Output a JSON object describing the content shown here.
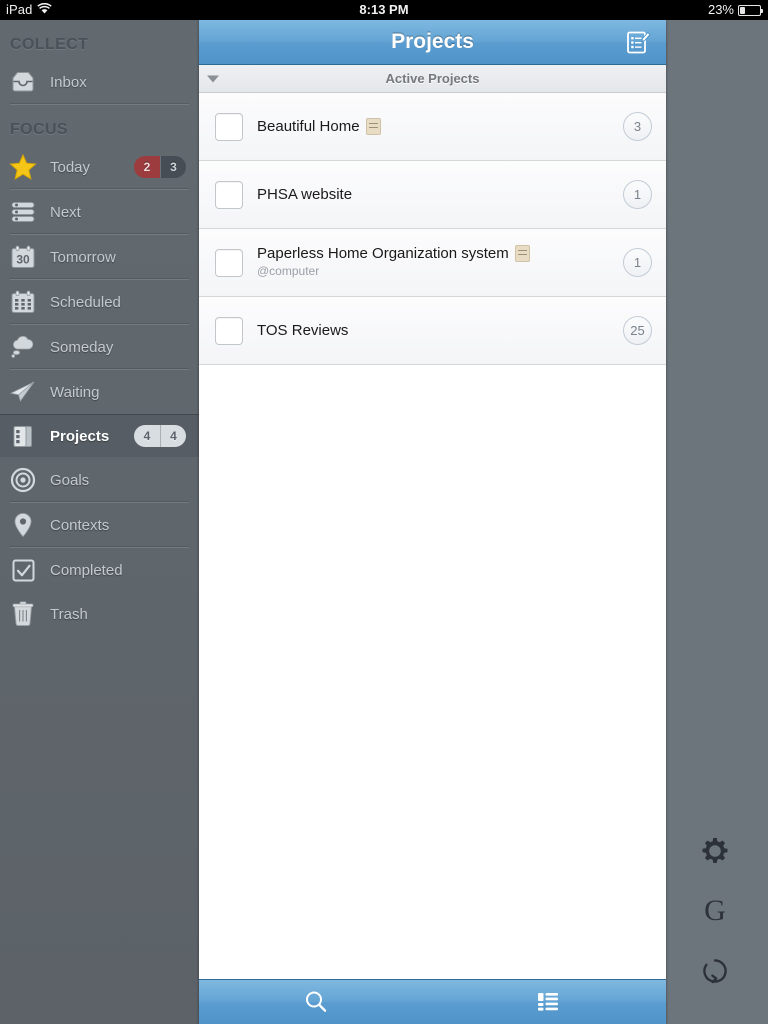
{
  "statusbar": {
    "device": "iPad",
    "wifi_icon": "wifi-icon",
    "time": "8:13 PM",
    "battery_percent": "23%",
    "battery_icon": "battery-icon"
  },
  "sidebar": {
    "groups": [
      {
        "header": "COLLECT",
        "items": [
          {
            "label": "Inbox",
            "icon": "inbox-tray-icon",
            "selected": false,
            "badges": []
          }
        ]
      },
      {
        "header": "FOCUS",
        "items": [
          {
            "label": "Today",
            "icon": "star-icon",
            "selected": false,
            "badges": [
              {
                "value": "2",
                "style": "red"
              },
              {
                "value": "3",
                "style": "dark"
              }
            ]
          },
          {
            "label": "Next",
            "icon": "list-stack-icon",
            "selected": false,
            "badges": []
          },
          {
            "label": "Tomorrow",
            "icon": "calendar-30-icon",
            "selected": false,
            "badges": []
          },
          {
            "label": "Scheduled",
            "icon": "calendar-grid-icon",
            "selected": false,
            "badges": []
          },
          {
            "label": "Someday",
            "icon": "thought-cloud-icon",
            "selected": false,
            "badges": []
          },
          {
            "label": "Waiting",
            "icon": "paper-plane-icon",
            "selected": false,
            "badges": []
          },
          {
            "label": "Projects",
            "icon": "projects-binder-icon",
            "selected": true,
            "badges": [
              {
                "value": "4",
                "style": "light"
              },
              {
                "value": "4",
                "style": "light"
              }
            ]
          },
          {
            "label": "Goals",
            "icon": "target-icon",
            "selected": false,
            "badges": []
          },
          {
            "label": "Contexts",
            "icon": "map-pin-icon",
            "selected": false,
            "badges": []
          },
          {
            "label": "Completed",
            "icon": "checkbox-checked-icon",
            "selected": false,
            "badges": []
          },
          {
            "label": "Trash",
            "icon": "trash-icon",
            "selected": false,
            "badges": []
          }
        ]
      }
    ]
  },
  "main": {
    "navbar": {
      "title": "Projects",
      "compose_icon": "compose-note-icon"
    },
    "section": {
      "title": "Active Projects",
      "collapse_icon": "triangle-down-icon",
      "expanded": true
    },
    "rows": [
      {
        "title": "Beautiful Home",
        "subtitle": "",
        "has_note": true,
        "count": "3"
      },
      {
        "title": "PHSA website",
        "subtitle": "",
        "has_note": false,
        "count": "1"
      },
      {
        "title": "Paperless Home Organization system",
        "subtitle": "@computer",
        "has_note": true,
        "count": "1"
      },
      {
        "title": "TOS Reviews",
        "subtitle": "",
        "has_note": false,
        "count": "25"
      }
    ],
    "toolbar": {
      "search_icon": "search-icon",
      "group_icon": "group-list-icon"
    }
  },
  "right_rail": {
    "settings_icon": "gear-icon",
    "g_label": "G",
    "sync_icon": "sync-refresh-icon"
  },
  "colors": {
    "accent_blue": "#63a4d4",
    "sidebar_bg": "#5f666d",
    "badge_red": "#9c3c3f",
    "note_tan": "#e8dcc4"
  }
}
